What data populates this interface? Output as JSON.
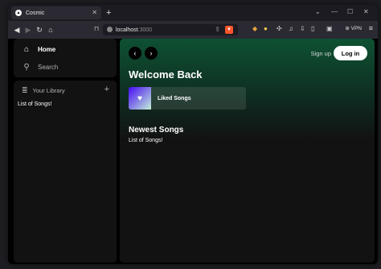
{
  "browser": {
    "tab_title": "Cosmic",
    "url_host": "localhost",
    "url_port": ":3000",
    "vpn_label": "VPN",
    "accent_color": "#fb542b"
  },
  "sidebar": {
    "home_label": "Home",
    "search_label": "Search",
    "library_label": "Your Library",
    "library_empty": "List of Songs!"
  },
  "header": {
    "signup_label": "Sign up",
    "login_label": "Log in"
  },
  "main": {
    "welcome_title": "Welcome Back",
    "liked_songs_label": "Liked Songs",
    "newest_title": "Newest Songs",
    "newest_sub": "List of Songs!"
  }
}
